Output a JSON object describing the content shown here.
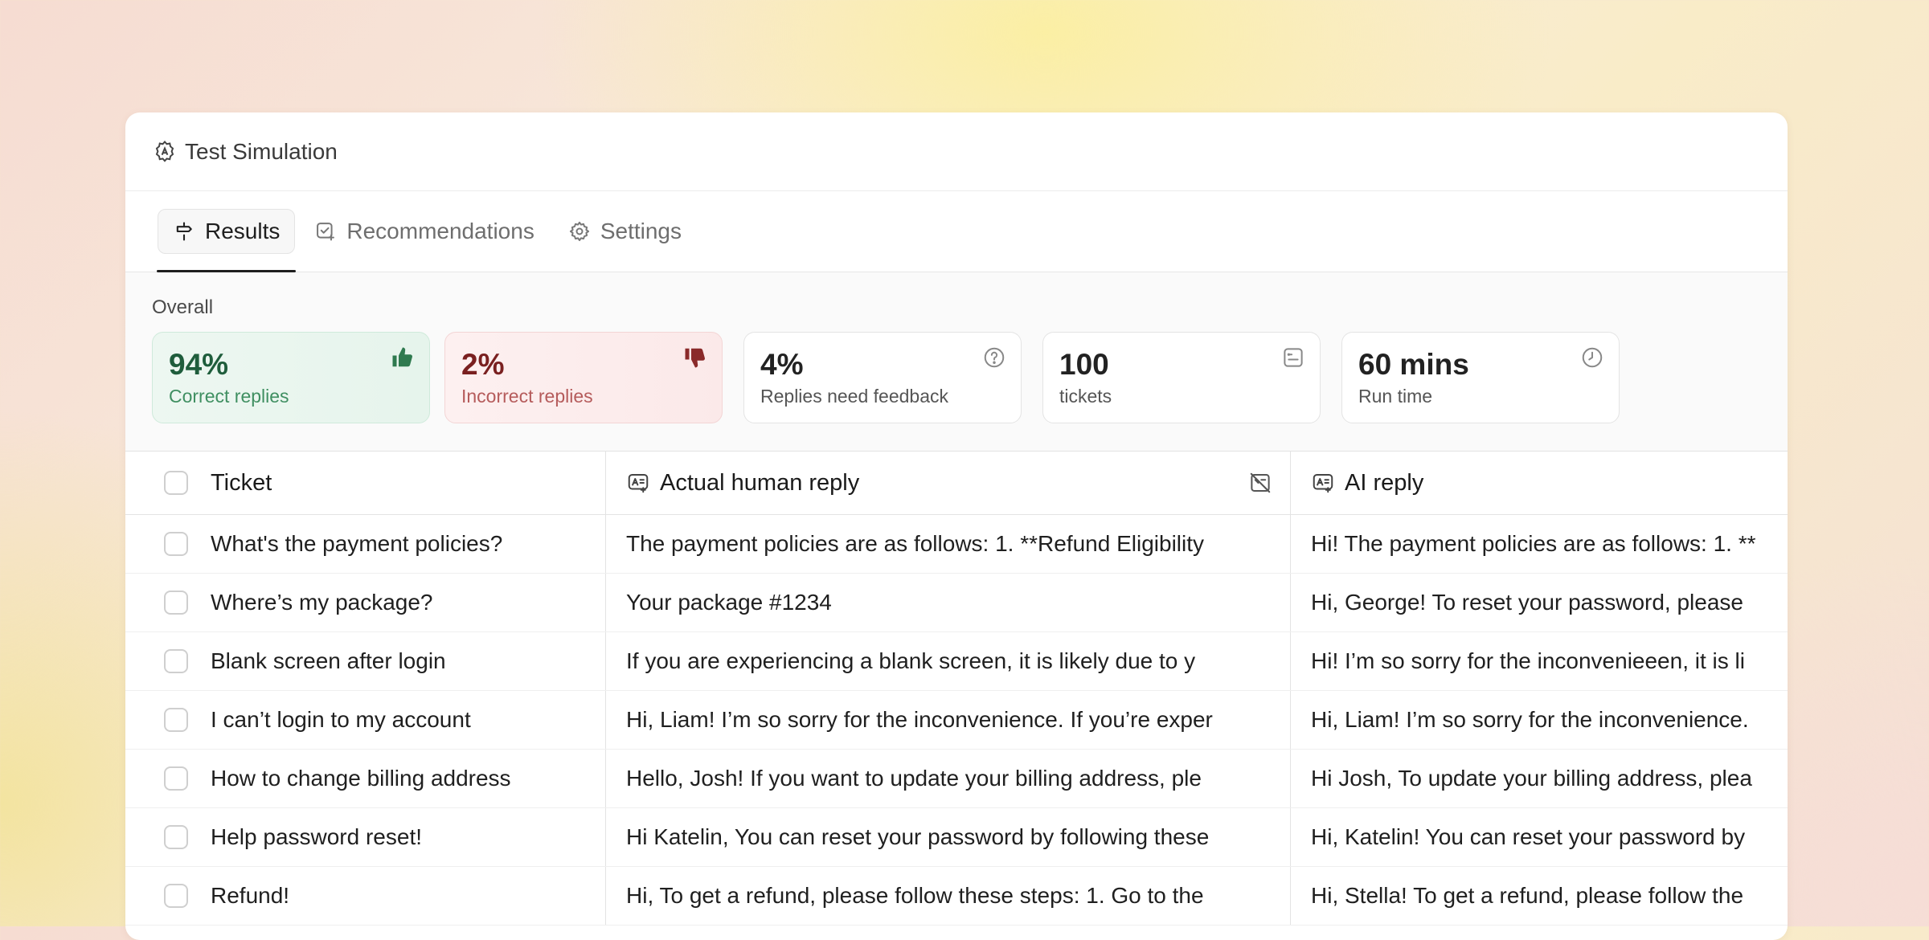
{
  "window": {
    "title": "Test Simulation"
  },
  "tabs": [
    {
      "label": "Results",
      "icon": "signpost-icon",
      "active": true
    },
    {
      "label": "Recommendations",
      "icon": "checklist-icon",
      "active": false
    },
    {
      "label": "Settings",
      "icon": "gear-icon",
      "active": false
    }
  ],
  "overall": {
    "label": "Overall",
    "cards": [
      {
        "value": "94%",
        "label": "Correct replies",
        "icon": "thumbs-up-icon",
        "color": "#1f5d3c"
      },
      {
        "value": "2%",
        "label": "Incorrect replies",
        "icon": "thumbs-down-icon",
        "color": "#7a2020"
      },
      {
        "value": "4%",
        "label": "Replies need feedback",
        "icon": "question-circle-icon"
      },
      {
        "value": "100",
        "label": "tickets",
        "icon": "ticket-icon"
      },
      {
        "value": "60 mins",
        "label": "Run time",
        "icon": "clock-icon"
      }
    ]
  },
  "table": {
    "columns": {
      "ticket": "Ticket",
      "human": "Actual human reply",
      "ai": "AI reply"
    },
    "rows": [
      {
        "ticket": "What's the payment policies?",
        "human": "The payment policies are as follows: 1. **Refund Eligibility",
        "ai": "Hi! The payment policies are as follows: 1. **"
      },
      {
        "ticket": "Where’s my package?",
        "human": "Your package #1234",
        "ai": "Hi, George! To reset your password, please"
      },
      {
        "ticket": "Blank screen after login",
        "human": "If you are experiencing a blank screen, it is likely due to y",
        "ai": "Hi! I’m so sorry for the inconvenieeen, it is li"
      },
      {
        "ticket": "I can’t login to my account",
        "human": "Hi, Liam! I’m so sorry for the inconvenience. If you’re exper",
        "ai": "Hi, Liam! I’m so sorry for the inconvenience."
      },
      {
        "ticket": "How to change billing address",
        "human": "Hello, Josh! If you want to update your billing address, ple",
        "ai": "Hi Josh, To update your billing address, plea"
      },
      {
        "ticket": "Help password reset!",
        "human": "Hi Katelin, You can reset your password by following these",
        "ai": "Hi, Katelin! You can reset your password by"
      },
      {
        "ticket": "Refund!",
        "human": "Hi, To get a refund, please follow these steps: 1. Go to the",
        "ai": "Hi, Stella! To get a refund, please follow the"
      }
    ]
  }
}
